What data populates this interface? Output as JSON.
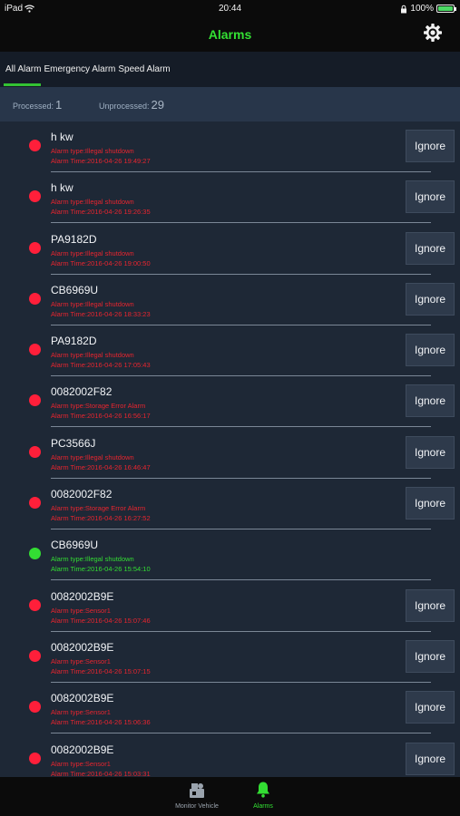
{
  "status_bar": {
    "device": "iPad",
    "time": "20:44",
    "battery": "100%",
    "battery_level": 1.0
  },
  "header": {
    "title": "Alarms",
    "settings_icon": "gear-icon"
  },
  "filter_tabs": [
    "All Alarm",
    "Emergency Alarm",
    "Speed Alarm"
  ],
  "active_tab_index": 0,
  "counts": {
    "processed_label": "Processed:",
    "processed_value": "1",
    "unprocessed_label": "Unprocessed:",
    "unprocessed_value": "29"
  },
  "ignore_label": "Ignore",
  "colors": {
    "accent": "#33e033",
    "alarm_unprocessed": "#ff1f3a",
    "alarm_processed": "#33dd33",
    "text_unprocessed": "#e8252f",
    "text_processed": "#33dd33"
  },
  "alarms": [
    {
      "plate": "h kw",
      "type": "Alarm type:Illegal shutdown",
      "time": "Alarm Time:2016-04-26 19:49:27",
      "processed": false
    },
    {
      "plate": "h kw",
      "type": "Alarm type:Illegal shutdown",
      "time": "Alarm Time:2016-04-26 19:26:35",
      "processed": false
    },
    {
      "plate": "PA9182D",
      "type": "Alarm type:Illegal shutdown",
      "time": "Alarm Time:2016-04-26 19:00:50",
      "processed": false
    },
    {
      "plate": "CB6969U",
      "type": "Alarm type:Illegal shutdown",
      "time": "Alarm Time:2016-04-26 18:33:23",
      "processed": false
    },
    {
      "plate": "PA9182D",
      "type": "Alarm type:Illegal shutdown",
      "time": "Alarm Time:2016-04-26 17:05:43",
      "processed": false
    },
    {
      "plate": "0082002F82",
      "type": "Alarm type:Storage Error Alarm",
      "time": "Alarm Time:2016-04-26 16:56:17",
      "processed": false
    },
    {
      "plate": "PC3566J",
      "type": "Alarm type:Illegal shutdown",
      "time": "Alarm Time:2016-04-26 16:46:47",
      "processed": false
    },
    {
      "plate": "0082002F82",
      "type": "Alarm type:Storage Error Alarm",
      "time": "Alarm Time:2016-04-26 16:27:52",
      "processed": false
    },
    {
      "plate": "CB6969U",
      "type": "Alarm type:Illegal shutdown",
      "time": "Alarm Time:2016-04-26 15:54:10",
      "processed": true
    },
    {
      "plate": "0082002B9E",
      "type": "Alarm type:Sensor1",
      "time": "Alarm Time:2016-04-26 15:07:46",
      "processed": false
    },
    {
      "plate": "0082002B9E",
      "type": "Alarm type:Sensor1",
      "time": "Alarm Time:2016-04-26 15:07:15",
      "processed": false
    },
    {
      "plate": "0082002B9E",
      "type": "Alarm type:Sensor1",
      "time": "Alarm Time:2016-04-26 15:06:36",
      "processed": false
    },
    {
      "plate": "0082002B9E",
      "type": "Alarm type:Sensor1",
      "time": "Alarm Time:2016-04-26 15:03:31",
      "processed": false
    }
  ],
  "bottom_tabs": [
    {
      "label": "Monitor Vehicle",
      "icon": "monitor-vehicle-icon",
      "active": false
    },
    {
      "label": "Alarms",
      "icon": "bell-icon",
      "active": true
    }
  ]
}
